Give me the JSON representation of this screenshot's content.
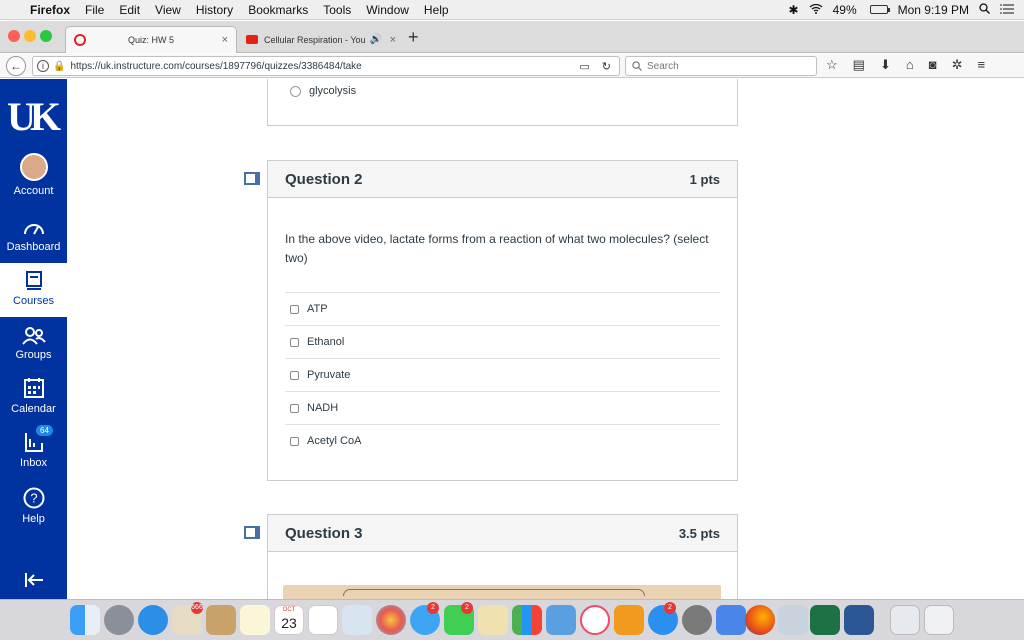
{
  "menubar": {
    "app": "Firefox",
    "menus": [
      "File",
      "Edit",
      "View",
      "History",
      "Bookmarks",
      "Tools",
      "Window",
      "Help"
    ],
    "battery": "49%",
    "clock": "Mon 9:19 PM"
  },
  "tabs": [
    {
      "title": "Quiz: HW 5",
      "close": "×"
    },
    {
      "title": "Cellular Respiration - You",
      "close": "×"
    }
  ],
  "navbar": {
    "url": "https://uk.instructure.com/courses/1897796/quizzes/3386484/take",
    "search_placeholder": "Search"
  },
  "sidebar": {
    "logo": "UK",
    "items": [
      {
        "label": "Account"
      },
      {
        "label": "Dashboard"
      },
      {
        "label": "Courses"
      },
      {
        "label": "Groups"
      },
      {
        "label": "Calendar"
      },
      {
        "label": "Inbox",
        "badge": "64"
      },
      {
        "label": "Help"
      }
    ],
    "collapse_icon": "collapse-arrow-icon"
  },
  "question1": {
    "visible_answer": "glycolysis"
  },
  "question2": {
    "title": "Question 2",
    "points": "1 pts",
    "text": "In the above video, lactate forms from a reaction of what two molecules? (select two)",
    "answers": [
      "ATP",
      "Ethanol",
      "Pyruvate",
      "NADH",
      "Acetyl CoA"
    ]
  },
  "question3": {
    "title": "Question 3",
    "points": "3.5 pts"
  },
  "dock": {
    "badges": {
      "photos": "666",
      "messages": "2",
      "facetime": "2",
      "appstore": "2"
    },
    "calendar_month": "OCT",
    "calendar_day": "23"
  },
  "colors": {
    "sidebar": "#0033a0",
    "accent": "#4a6fa5"
  }
}
